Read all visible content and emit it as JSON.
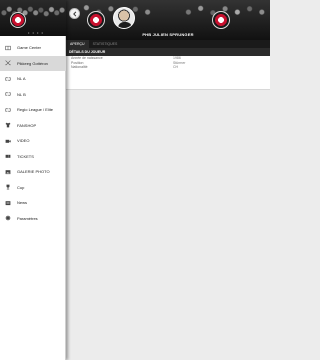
{
  "sidebar": {
    "pagination_dots": "• • • •",
    "items": [
      {
        "label": "Game Center",
        "icon": "scoreboard-icon"
      },
      {
        "label": "Pikkeeg Gottéron",
        "icon": "hockey-sticks-icon"
      },
      {
        "label": "NL A",
        "icon": "league-arrows-icon"
      },
      {
        "label": "NL B",
        "icon": "league-arrows-icon"
      },
      {
        "label": "Regio League / Elite",
        "icon": "league-arrows-icon"
      },
      {
        "label": "FANSHOP",
        "icon": "shirt-icon"
      },
      {
        "label": "VIDEO",
        "icon": "video-camera-icon"
      },
      {
        "label": "TICKETS",
        "icon": "ticket-icon"
      },
      {
        "label": "GALERIE PHOTO",
        "icon": "photo-icon"
      },
      {
        "label": "Cup",
        "icon": "trophy-icon"
      },
      {
        "label": "News",
        "icon": "news-icon"
      },
      {
        "label": "Paramètres",
        "icon": "gear-icon"
      }
    ],
    "active_index": 1
  },
  "header": {
    "player_name": "PHB JULIEN SPRUNGER"
  },
  "tabs": [
    {
      "label": "APERÇU"
    },
    {
      "label": "STATISTIQUES"
    }
  ],
  "active_tab": 0,
  "details": {
    "title": "DÉTAILS DU JOUEUR",
    "rows": [
      {
        "label": "Année de naissance",
        "value": "1986"
      },
      {
        "label": "Position",
        "value": "Stürmer"
      },
      {
        "label": "Nationalité",
        "value": "CH"
      }
    ]
  },
  "colors": {
    "header_bg": "#111111",
    "sidebar_bg": "#ffffff",
    "active_item_bg": "#d9d9d9",
    "brand_red": "#c8102e"
  }
}
